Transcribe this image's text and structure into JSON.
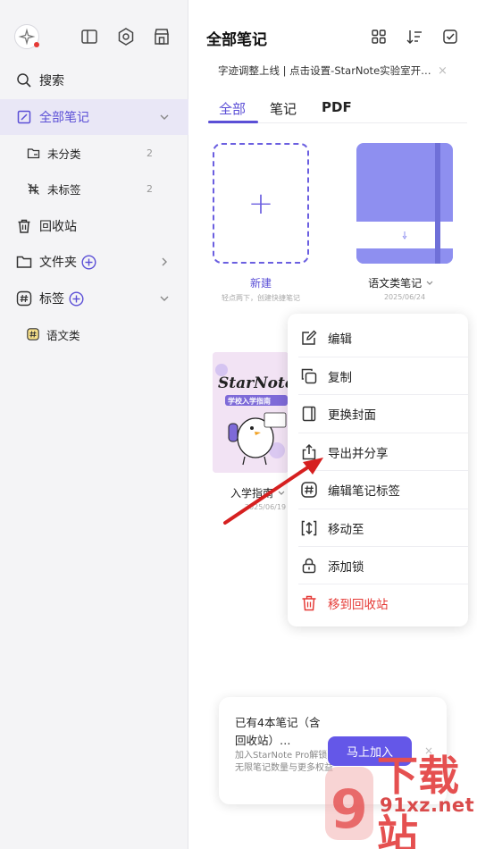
{
  "sidebar": {
    "search": "搜索",
    "items": [
      {
        "label": "全部笔记"
      },
      {
        "label": "未分类",
        "count": "2"
      },
      {
        "label": "未标签",
        "count": "2"
      },
      {
        "label": "回收站"
      },
      {
        "label": "文件夹"
      },
      {
        "label": "标签"
      },
      {
        "label": "语文类"
      }
    ]
  },
  "header": {
    "title": "全部笔记"
  },
  "notice": {
    "text": "字迹调整上线 | 点击设置-StarNote实验室开…",
    "close": "×"
  },
  "tabs": [
    {
      "label": "全部"
    },
    {
      "label": "笔记"
    },
    {
      "label": "PDF"
    }
  ],
  "notes": {
    "new": {
      "plus": "+",
      "title": "新建",
      "hint": "轻点两下，创建快捷笔记"
    },
    "chinese": {
      "title": "语文类笔记",
      "date": "2025/06/24"
    },
    "guide": {
      "title": "入学指南",
      "date": "2025/06/19",
      "cover_title": "StarNote",
      "cover_sub": "学校入学指南"
    }
  },
  "context_menu": [
    {
      "label": "编辑"
    },
    {
      "label": "复制"
    },
    {
      "label": "更换封面"
    },
    {
      "label": "导出并分享"
    },
    {
      "label": "编辑笔记标签"
    },
    {
      "label": "移动至"
    },
    {
      "label": "添加锁"
    },
    {
      "label": "移到回收站"
    }
  ],
  "promo": {
    "title": "已有4本笔记（含回收站）…",
    "desc": "加入StarNote Pro解锁无限笔记数量与更多权益",
    "button": "马上加入",
    "close": "×"
  },
  "watermark": {
    "big": "下载站",
    "site": "91xz.net"
  },
  "colors": {
    "accent": "#5b4fd6",
    "danger": "#e53935",
    "arrow": "#d62020"
  }
}
